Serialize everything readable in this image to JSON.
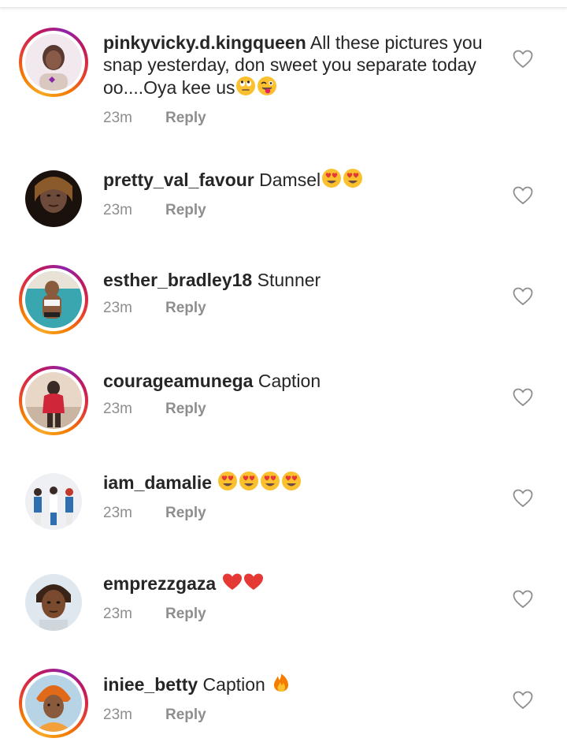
{
  "comments": [
    {
      "username": "pinkyvicky.d.kingqueen",
      "text_line1": "All these pictures you",
      "text_line2": "snap yesterday, don sweet you separate today",
      "text_line3": "oo....Oya kee us",
      "emojis": [
        "eye-roll-emoji",
        "winking-tongue-emoji"
      ],
      "time": "23m",
      "reply": "Reply",
      "story_ring": true,
      "avatar_colors": [
        "#d8c8c0",
        "#3a2a25",
        "#f2e9ef"
      ]
    },
    {
      "username": "pretty_val_favour",
      "text": "Damsel",
      "emojis": [
        "heart-eyes-emoji",
        "heart-eyes-emoji"
      ],
      "time": "23m",
      "reply": "Reply",
      "story_ring": false,
      "avatar_colors": [
        "#2b1a14",
        "#6e4a3a",
        "#8a5a2b"
      ]
    },
    {
      "username": "esther_bradley18",
      "text": "Stunner",
      "emojis": [],
      "time": "23m",
      "reply": "Reply",
      "story_ring": true,
      "avatar_colors": [
        "#3aa7b0",
        "#8a5a3c",
        "#e9e2d6"
      ]
    },
    {
      "username": "courageamunega",
      "text": "Caption",
      "emojis": [],
      "time": "23m",
      "reply": "Reply",
      "story_ring": true,
      "avatar_colors": [
        "#e8d6c6",
        "#d0263a",
        "#3a2a25"
      ]
    },
    {
      "username": "iam_damalie",
      "text": "",
      "emojis": [
        "heart-eyes-emoji",
        "heart-eyes-emoji",
        "heart-eyes-emoji",
        "heart-eyes-emoji"
      ],
      "time": "23m",
      "reply": "Reply",
      "story_ring": false,
      "avatar_colors": [
        "#eef0f4",
        "#2f6fb0",
        "#c0392b"
      ]
    },
    {
      "username": "emprezzgaza",
      "text": "",
      "emojis": [
        "red-heart-emoji",
        "red-heart-emoji"
      ],
      "time": "23m",
      "reply": "Reply",
      "story_ring": false,
      "avatar_colors": [
        "#3a2418",
        "#7a4a2e",
        "#dfe8ef"
      ]
    },
    {
      "username": "iniee_betty",
      "text": "Caption",
      "emojis": [
        "fire-emoji"
      ],
      "time": "23m",
      "reply": "Reply",
      "story_ring": true,
      "avatar_colors": [
        "#e06a1a",
        "#f2a03c",
        "#b7d4e6"
      ]
    }
  ],
  "colors": {
    "text": "#262626",
    "meta": "#8e8e8e",
    "heart_outline": "#8e8e8e",
    "ring_start": "#f9a825",
    "ring_end": "#8e24aa"
  }
}
